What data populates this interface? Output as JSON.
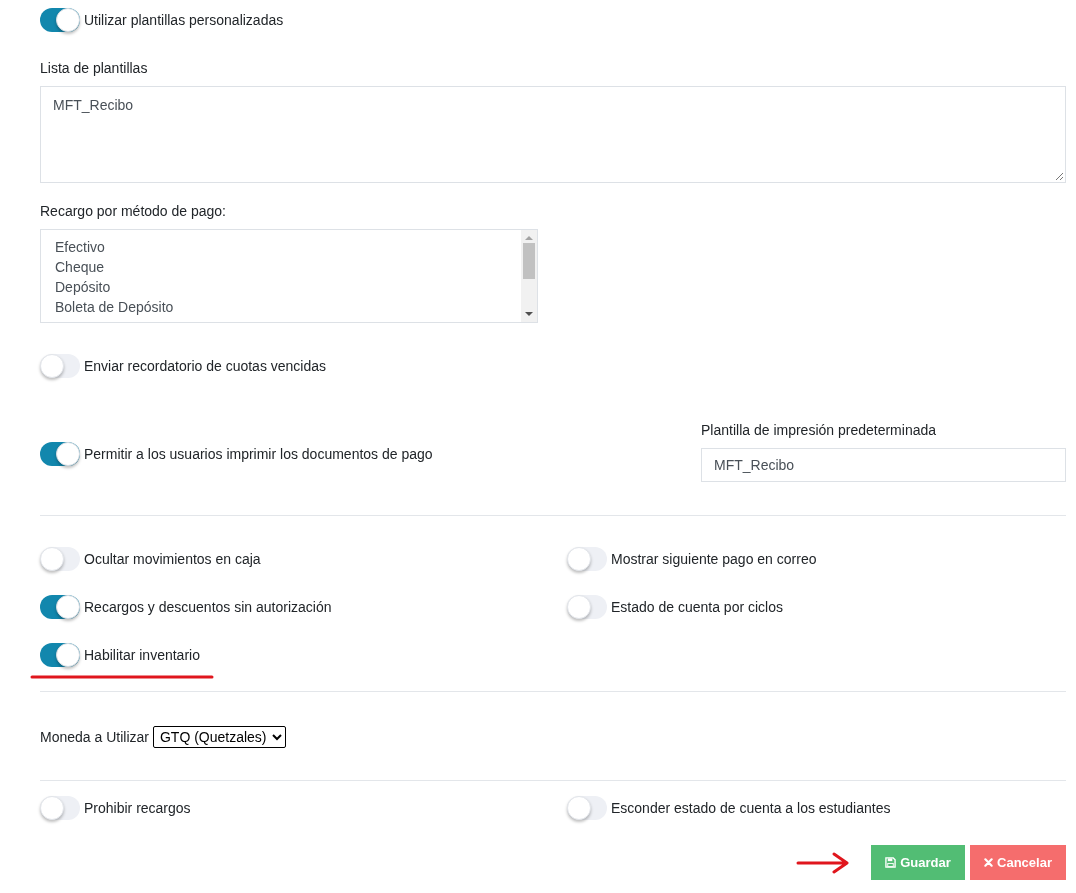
{
  "custom_templates": {
    "label": "Utilizar plantillas personalizadas",
    "on": true
  },
  "template_list": {
    "label": "Lista de plantillas",
    "value": "MFT_Recibo"
  },
  "surcharge_by_payment_method": {
    "label": "Recargo por método de pago:",
    "options": [
      {
        "label": "Efectivo",
        "selected": false
      },
      {
        "label": "Cheque",
        "selected": false
      },
      {
        "label": "Depósito",
        "selected": false
      },
      {
        "label": "Boleta de Depósito",
        "selected": false
      }
    ]
  },
  "overdue_reminder": {
    "label": "Enviar recordatorio de cuotas vencidas",
    "on": false
  },
  "allow_printing": {
    "label": "Permitir a los usuarios imprimir los documentos de pago",
    "on": true
  },
  "default_print_template": {
    "label": "Plantilla de impresión predeterminada",
    "value": "MFT_Recibo"
  },
  "options": {
    "left": [
      {
        "label": "Ocultar movimientos en caja",
        "on": false
      },
      {
        "label": "Recargos y descuentos sin autorización",
        "on": true
      },
      {
        "label": "Habilitar inventario",
        "on": true
      }
    ],
    "right": [
      {
        "label": "Mostrar siguiente pago en correo",
        "on": false
      },
      {
        "label": "Estado de cuenta por ciclos",
        "on": false
      }
    ]
  },
  "currency": {
    "label": "Moneda a Utilizar",
    "value": "GTQ (Quetzales)"
  },
  "final_options": {
    "left": [
      {
        "label": "Prohibir recargos",
        "on": false
      }
    ],
    "right": [
      {
        "label": "Esconder estado de cuenta a los estudiantes",
        "on": false
      }
    ]
  },
  "buttons": [
    {
      "label": "Guardar",
      "kind": "save"
    },
    {
      "label": "Cancelar",
      "kind": "cancel"
    }
  ]
}
